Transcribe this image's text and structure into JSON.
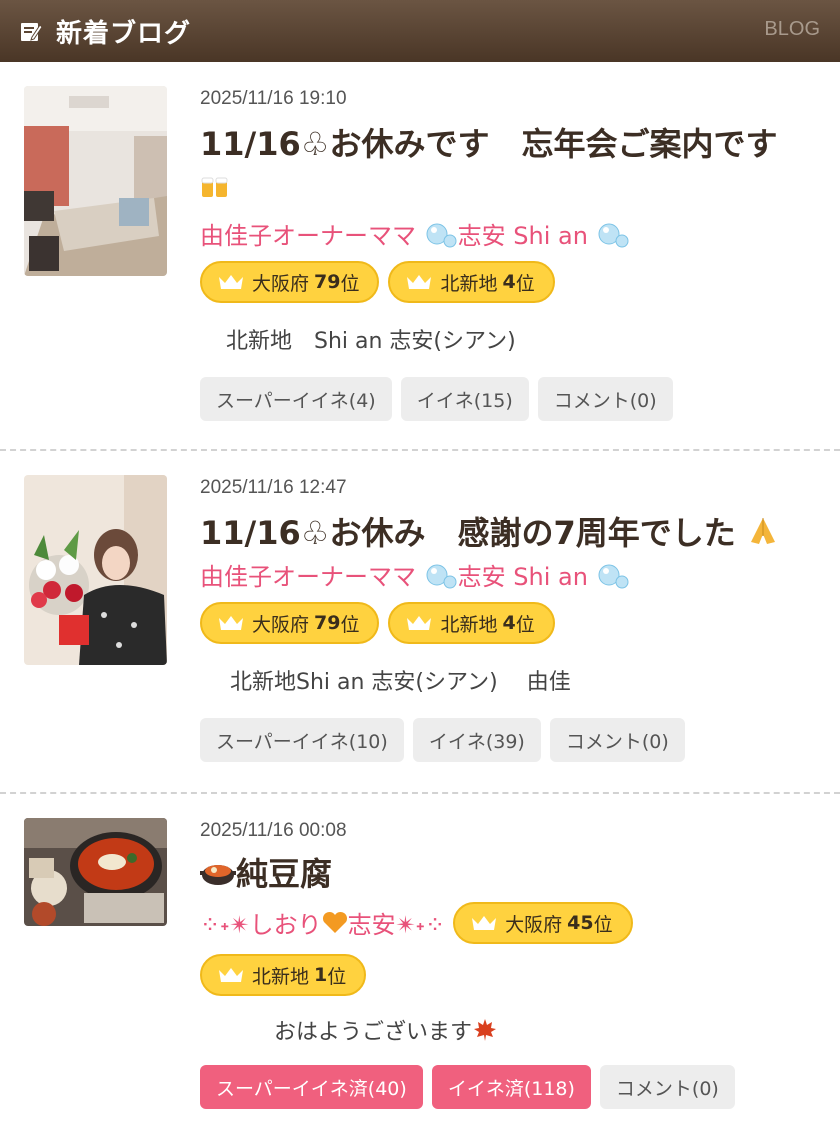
{
  "header": {
    "title": "新着ブログ",
    "link": "BLOG"
  },
  "posts": [
    {
      "date": "2025/11/16 19:10",
      "title_line1": "11/16♧お休みです　忘年会ご案内です",
      "author": "由佳子オーナーママ",
      "shop": "志安 Shi an",
      "badge1": {
        "region": "大阪府",
        "rank": "79",
        "suffix": "位"
      },
      "badge2": {
        "region": "北新地",
        "rank": "4",
        "suffix": "位"
      },
      "excerpt": "北新地　Shi an 志安(シアン)",
      "super_like": "スーパーイイネ(4)",
      "like": "イイネ(15)",
      "comment": "コメント(0)"
    },
    {
      "date": "2025/11/16 12:47",
      "title": "11/16♧お休み　感謝の7周年でした",
      "author": "由佳子オーナーママ",
      "shop": "志安 Shi an",
      "badge1": {
        "region": "大阪府",
        "rank": "79",
        "suffix": "位"
      },
      "badge2": {
        "region": "北新地",
        "rank": "4",
        "suffix": "位"
      },
      "excerpt": "北新地Shi an 志安(シアン)　 由佳",
      "super_like": "スーパーイイネ(10)",
      "like": "イイネ(39)",
      "comment": "コメント(0)"
    },
    {
      "date": "2025/11/16 00:08",
      "title": "純豆腐",
      "author_pre": "⁘˖✴︎しおり",
      "author_mid": "志安✴︎˖⁘",
      "badge1": {
        "region": "大阪府",
        "rank": "45",
        "suffix": "位"
      },
      "badge2": {
        "region": "北新地",
        "rank": "1",
        "suffix": "位"
      },
      "excerpt": "おはようございます",
      "super_like": "スーパーイイネ済(40)",
      "like": "イイネ済(118)",
      "comment": "コメント(0)"
    }
  ],
  "colors": {
    "header": "#5b4533",
    "author": "#e8527a",
    "badge": "#ffd23f",
    "liked": "#f0607e"
  },
  "icons": [
    "edit-icon",
    "crown-icon",
    "bubbles-icon",
    "beer-icon",
    "pray-icon",
    "pot-icon",
    "heart-icon",
    "maple-leaf-icon"
  ]
}
